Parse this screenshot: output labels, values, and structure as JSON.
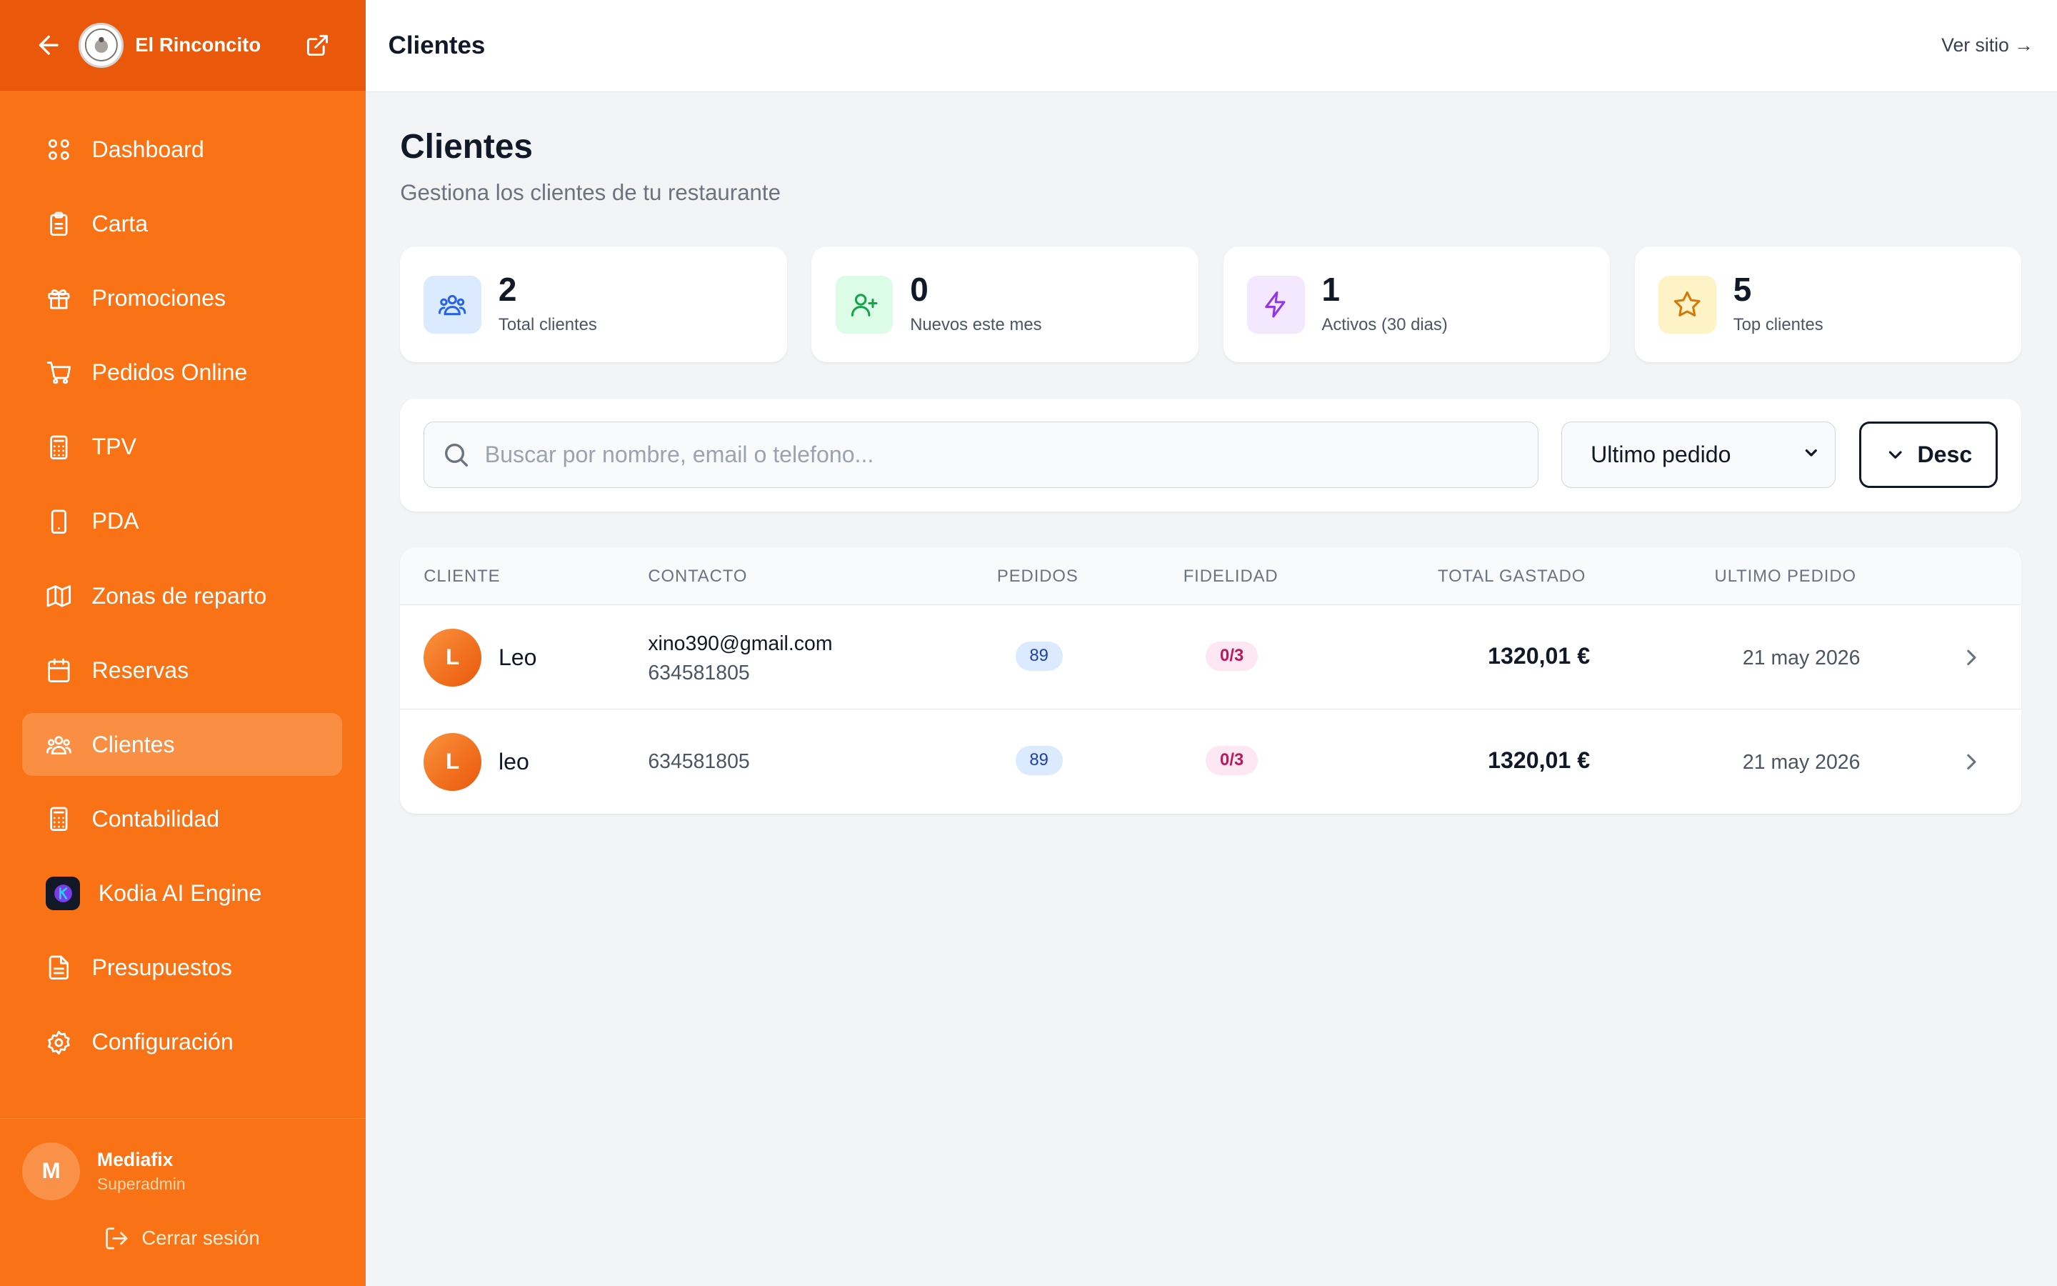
{
  "sidebar": {
    "brand": "El Rinconcito",
    "nav": [
      {
        "label": "Dashboard",
        "icon": "grid-icon"
      },
      {
        "label": "Carta",
        "icon": "clipboard-icon"
      },
      {
        "label": "Promociones",
        "icon": "gift-icon"
      },
      {
        "label": "Pedidos Online",
        "icon": "cart-icon"
      },
      {
        "label": "TPV",
        "icon": "calculator-icon"
      },
      {
        "label": "PDA",
        "icon": "smartphone-icon"
      },
      {
        "label": "Zonas de reparto",
        "icon": "map-icon"
      },
      {
        "label": "Reservas",
        "icon": "calendar-icon"
      },
      {
        "label": "Clientes",
        "icon": "users-icon",
        "active": true
      },
      {
        "label": "Contabilidad",
        "icon": "calculator-icon"
      },
      {
        "label": "Kodia AI Engine",
        "icon": "kodia-logo-icon"
      },
      {
        "label": "Presupuestos",
        "icon": "file-text-icon"
      },
      {
        "label": "Configuración",
        "icon": "gear-icon"
      }
    ],
    "user": {
      "initial": "M",
      "name": "Mediafix",
      "role": "Superadmin"
    },
    "logout_label": "Cerrar sesión"
  },
  "topbar": {
    "title": "Clientes",
    "link": "Ver sitio →"
  },
  "page": {
    "title": "Clientes",
    "subtitle": "Gestiona los clientes de tu restaurante"
  },
  "stats": [
    {
      "value": "2",
      "label": "Total clientes",
      "icon": "users-icon",
      "bg": "#dbeafe",
      "fg": "#2563eb"
    },
    {
      "value": "0",
      "label": "Nuevos este mes",
      "icon": "user-plus-icon",
      "bg": "#dcfce7",
      "fg": "#16a34a"
    },
    {
      "value": "1",
      "label": "Activos (30 dias)",
      "icon": "zap-icon",
      "bg": "#f3e8ff",
      "fg": "#9333ea"
    },
    {
      "value": "5",
      "label": "Top clientes",
      "icon": "star-icon",
      "bg": "#fef3c7",
      "fg": "#d97706"
    }
  ],
  "filters": {
    "search_placeholder": "Buscar por nombre, email o telefono...",
    "sort_value": "Ultimo pedido",
    "order_label": "Desc"
  },
  "table": {
    "columns": [
      "CLIENTE",
      "CONTACTO",
      "PEDIDOS",
      "FIDELIDAD",
      "TOTAL GASTADO",
      "ULTIMO PEDIDO"
    ],
    "rows": [
      {
        "initial": "L",
        "name": "Leo",
        "email": "xino390@gmail.com",
        "phone": "634581805",
        "orders": "89",
        "loyalty": "0/3",
        "total": "1320,01 €",
        "last_order": "21 may 2026"
      },
      {
        "initial": "L",
        "name": "leo",
        "email": "",
        "phone": "634581805",
        "orders": "89",
        "loyalty": "0/3",
        "total": "1320,01 €",
        "last_order": "21 may 2026"
      }
    ]
  },
  "colors": {
    "sidebar": "#f97316",
    "sidebar_header": "#ea580c",
    "background": "#f3f4f6"
  }
}
